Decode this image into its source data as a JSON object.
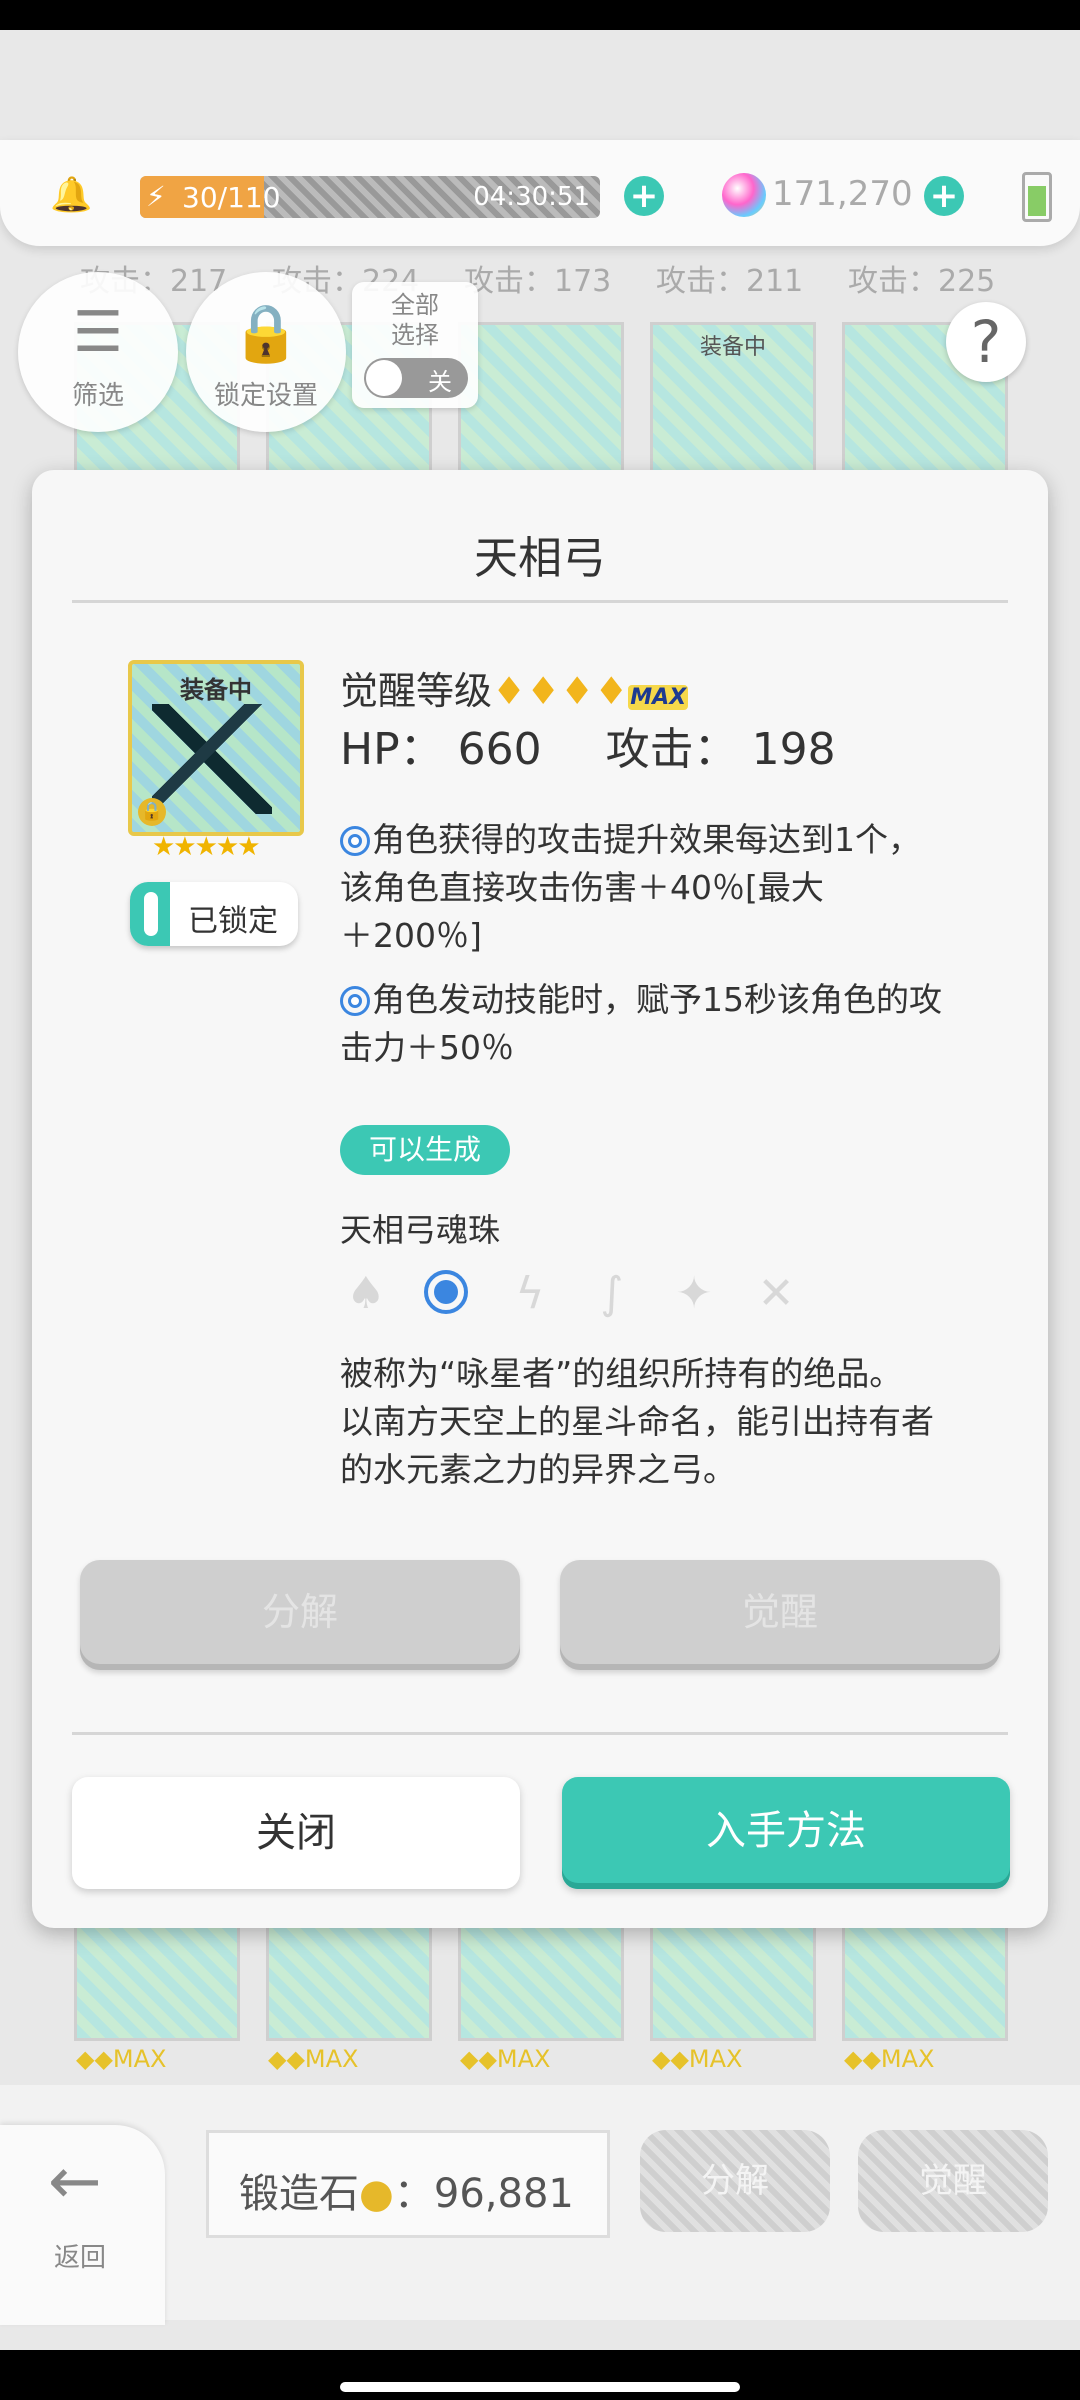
{
  "header": {
    "energy": {
      "current": 30,
      "max": 110,
      "text": "30/110",
      "timer": "04:30:51",
      "fill_fraction": 0.27
    },
    "gems": "171,270",
    "icons": [
      "bell-icon",
      "lightning-icon",
      "add-icon",
      "gem-icon",
      "add-icon",
      "battery-icon"
    ]
  },
  "top_cards": {
    "attacks": [
      "攻击：217",
      "攻击：224",
      "攻击：173",
      "攻击：211",
      "攻击：225"
    ],
    "equipped_labels": [
      "装备中"
    ]
  },
  "controls": {
    "filter_label": "筛选",
    "lock_settings_label": "锁定设置",
    "select_all_label": "全部\n选择",
    "select_all_toggle": "关"
  },
  "modal": {
    "title": "天相弓",
    "equipped_badge": "装备中",
    "stars": "★★★★★",
    "locked_label": "已锁定",
    "awaken_label": "觉醒等级",
    "awaken_max": "MAX",
    "hp_text": "HP： 660",
    "atk_text": "攻击： 198",
    "effect1_lines": [
      "角色获得的攻击提升效果每达到1个，",
      "该角色直接攻击伤害＋40％[最大",
      "＋200％]"
    ],
    "effect2_lines": [
      "角色发动技能时，赋予15秒该角色的攻",
      "击力＋50％"
    ],
    "craftable_badge": "可以生成",
    "soul_label": "天相弓魂珠",
    "elements": [
      "earth-icon",
      "water-icon",
      "thunder-icon",
      "wind-icon",
      "light-icon",
      "dark-icon"
    ],
    "description_lines": [
      "被称为“咏星者”的组织所持有的绝品。",
      "以南方天空上的星斗命名，能引出持有者",
      "的水元素之力的异界之弓。"
    ],
    "disassemble_label": "分解",
    "awaken_button_label": "觉醒",
    "close_label": "关闭",
    "obtain_label": "入手方法"
  },
  "bottom": {
    "back_label": "返回",
    "forge_stone_label": "锻造石",
    "forge_stone_value": "：96,881",
    "disassemble_label": "分解",
    "awaken_label": "觉醒",
    "lower_max_label": "MAX"
  },
  "colors": {
    "accent": "#3cc8b4",
    "energy": "#f0a444",
    "select_blue": "#3b86e0",
    "gold": "#e8c84a"
  }
}
